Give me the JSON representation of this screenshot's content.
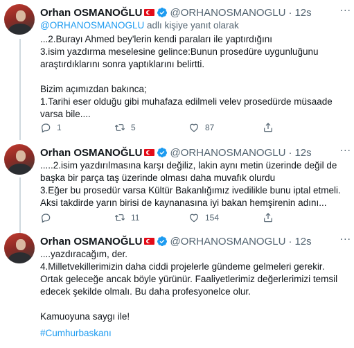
{
  "tweets": [
    {
      "name": "Orhan OSMANOĞLU",
      "handle": "@ORHANOSMANOGLU",
      "dot": "·",
      "time": "12s",
      "reply_to_mention": "@ORHANOSMANOGLU",
      "reply_to_suffix": " adlı kişiye yanıt olarak",
      "text": "...2.Burayı Ahmed bey'lerin kendi paraları ile yaptırdığını\n3.isim yazdırma meselesine gelince:Bunun prosedüre uygunluğunu araştırdıklarını sonra yaptıklarını belirtti.\n\nBizim açımızdan bakınca;\n1.Tarihi eser olduğu gibi muhafaza edilmeli velev prosedürde müsaade varsa bile....",
      "replies": "1",
      "retweets": "5",
      "likes": "87"
    },
    {
      "name": "Orhan OSMANOĞLU",
      "handle": "@ORHANOSMANOGLU",
      "dot": "·",
      "time": "12s",
      "text": ".....2.isim yazdırılmasına karşı değiliz, lakin aynı metin üzerinde değil de başka bir parça taş üzerinde olması daha muvafık olurdu\n3.Eğer bu prosedür varsa Kültür Bakanlığımız ivedilikle bunu iptal etmeli. Aksi takdirde yarın birisi de kaynanasına iyi bakan hemşirenin adını...",
      "replies": "",
      "retweets": "11",
      "likes": "154"
    },
    {
      "name": "Orhan OSMANOĞLU",
      "handle": "@ORHANOSMANOGLU",
      "dot": "·",
      "time": "12s",
      "text": "....yazdıracağım, der.\n4.Milletvekillerimizin daha ciddi projelerle gündeme gelmeleri gerekir. Ortak geleceğe ancak böyle yürünür. Faaliyetlerimiz değerlerimizi temsil edecek şekilde olmalı. Bu daha profesyonelce olur.\n\nKamuoyuna saygı ile!",
      "hashtag": "#Cumhurbaskanı"
    }
  ],
  "more_label": "···",
  "colors": {
    "accent": "#1d9bf0",
    "muted": "#536471",
    "flag_red": "#e30a17"
  }
}
